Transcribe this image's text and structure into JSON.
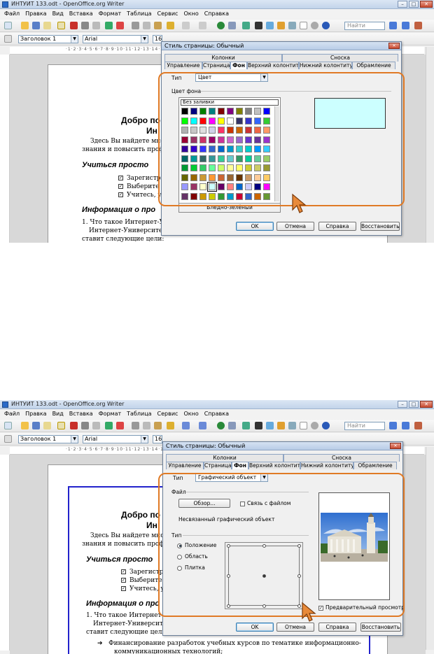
{
  "window": {
    "title": "ИНТУИТ 133.odt - OpenOffice.org Writer",
    "min": "–",
    "max": "□",
    "close": "✕"
  },
  "menu": [
    "Файл",
    "Правка",
    "Вид",
    "Вставка",
    "Формат",
    "Таблица",
    "Сервис",
    "Окно",
    "Справка"
  ],
  "toolbar": {
    "style_value": "Заголовок 1",
    "font_value": "Arial",
    "size_value": "16",
    "find_placeholder": "Найти"
  },
  "ruler_text": "·1·2·3·4·5·6·7·8·9·10·11·12·13·14·15·16·17",
  "document": {
    "heading1_a": "Добро по",
    "heading1_b": "Ин",
    "para1_a": "Здесь Вы найдете мно",
    "para1_b": "знания и повысить профе",
    "heading2_a": "Учиться просто",
    "check1": "Зарегистр",
    "check2": "Выберите",
    "check3": "Учитесь, у",
    "heading2_b": "Информация о про",
    "list1": "1. Что такое Интернет-Уни",
    "para2": "Интернет-Университет",
    "para3": "ставит следующие цели:",
    "bullet": "Финансирование разработок учебных курсов по тематике информационно-",
    "bullet_cont": "коммуникационных технологий;"
  },
  "dialog": {
    "title": "Стиль страницы: Обычный",
    "tabs_top": [
      "Колонки",
      "Сноска"
    ],
    "tabs_bottom": [
      "Управление",
      "Страница",
      "Фон",
      "Верхний колонтитул",
      "Нижний колонтитул",
      "Обрамление"
    ],
    "active_tab": "Фон",
    "type_label": "Тип",
    "buttons": {
      "ok": "OK",
      "cancel": "Отмена",
      "help": "Справка",
      "reset": "Восстановить"
    }
  },
  "step1": {
    "type_value": "Цвет",
    "group_label": "Цвет фона",
    "no_fill": "Без заливки",
    "selected_color_name": "Бледно-зелёный",
    "preview_color": "#ccffff",
    "palette": [
      [
        "#000000",
        "#000080",
        "#008000",
        "#008080",
        "#800000",
        "#800080",
        "#808000",
        "#808080",
        "#c0c0c0",
        "#0000ff"
      ],
      [
        "#00ff00",
        "#00ffff",
        "#ff0000",
        "#ff00ff",
        "#ffff00",
        "#ffffff",
        "#333366",
        "#3333cc",
        "#3366ff",
        "#33cc33"
      ],
      [
        "#b0b0b0",
        "#c8c8c8",
        "#e0e0e0",
        "#d0d0e8",
        "#ff3366",
        "#cc3300",
        "#cc6600",
        "#cc3333",
        "#ee6644",
        "#ff9966"
      ],
      [
        "#990033",
        "#993366",
        "#cc3366",
        "#990066",
        "#cc3399",
        "#cc66cc",
        "#9966cc",
        "#6633cc",
        "#663399",
        "#9933cc"
      ],
      [
        "#330099",
        "#3300cc",
        "#3333ff",
        "#3366cc",
        "#0066cc",
        "#0099cc",
        "#33cccc",
        "#00cccc",
        "#0099ff",
        "#33ccff"
      ],
      [
        "#006666",
        "#009999",
        "#336666",
        "#339999",
        "#33cc99",
        "#66cccc",
        "#339966",
        "#00cc99",
        "#66cc99",
        "#99cc66"
      ],
      [
        "#009933",
        "#00cc33",
        "#33cc66",
        "#66ff99",
        "#ccff66",
        "#ffff99",
        "#ffff66",
        "#cccc33",
        "#cccc66",
        "#999933"
      ],
      [
        "#666600",
        "#996600",
        "#cc9933",
        "#ff9933",
        "#cc6633",
        "#996633",
        "#663300",
        "#cc9966",
        "#ffcc99",
        "#ffcc66"
      ],
      [
        "#9999ff",
        "#993366",
        "#ffffcc",
        "#ccffff",
        "#660066",
        "#ff8080",
        "#0066cc",
        "#ccccff",
        "#000080",
        "#ff00ff"
      ],
      [
        "#663366",
        "#800000",
        "#cc9900",
        "#cccc00",
        "#339933",
        "#0099cc",
        "#cc0033",
        "#3366cc",
        "#cc6600",
        "#669933"
      ]
    ]
  },
  "step2": {
    "type_value": "Графический объект",
    "file_label": "Файл",
    "browse_btn": "Обзор...",
    "link_label": "Связь с файлом",
    "unlinked_text": "Несвязанный графический объект",
    "type_group": "Тип",
    "radio_position": "Положение",
    "radio_area": "Область",
    "radio_tile": "Плитка",
    "preview_label": "Предварительный просмотр",
    "preview_check": "✓",
    "check_mark": "☑"
  },
  "colors": {
    "highlight": "#e07a25",
    "cursor_fill": "#e88a3a"
  }
}
